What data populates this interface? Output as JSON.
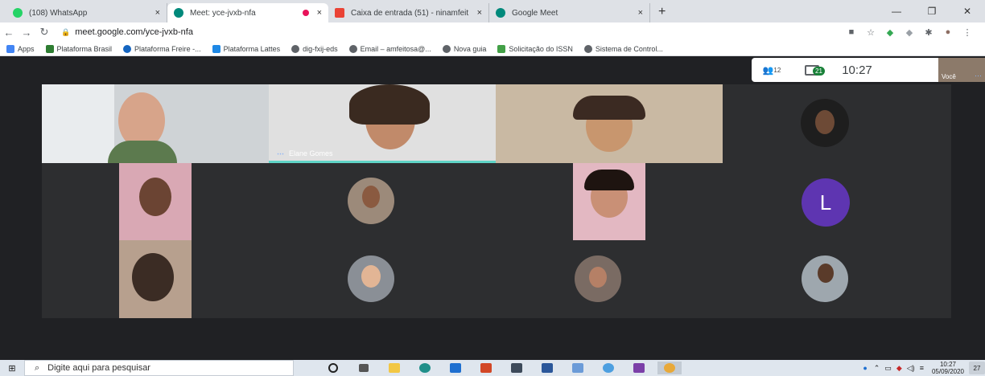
{
  "tabs": [
    {
      "title": "(108) WhatsApp",
      "color": "#25d366"
    },
    {
      "title": "Meet: yce-jvxb-nfa",
      "color": "#00897b"
    },
    {
      "title": "Caixa de entrada (51) - ninamfeit",
      "color": "#ea4335"
    },
    {
      "title": "Google Meet",
      "color": "#00897b"
    }
  ],
  "tab_close": "×",
  "new_tab": "+",
  "window": {
    "min": "—",
    "max": "❐",
    "close": "✕"
  },
  "url": "meet.google.com/yce-jvxb-nfa",
  "bookmarks": [
    {
      "label": "Apps",
      "color": "#4285f4"
    },
    {
      "label": "Plataforma Brasil",
      "color": "#2e7d32"
    },
    {
      "label": "Plataforma Freire -...",
      "color": "#1565c0"
    },
    {
      "label": "Plataforma Lattes",
      "color": "#1e88e5"
    },
    {
      "label": "dig-fxij-eds",
      "color": "#5f6368"
    },
    {
      "label": "Email – amfeitosa@...",
      "color": "#5f6368"
    },
    {
      "label": "Nova guia",
      "color": "#5f6368"
    },
    {
      "label": "Solicitação do ISSN",
      "color": "#43a047"
    },
    {
      "label": "Sistema de Control...",
      "color": "#5f6368"
    }
  ],
  "meet": {
    "participants": "12",
    "chat_badge": "21",
    "time": "10:27",
    "self_label": "Você",
    "self_dots": "⋯"
  },
  "tiles": {
    "speaker_name": "Elane Gomes",
    "letter_avatar": "L"
  },
  "taskbar": {
    "search_placeholder": "Digite aqui para pesquisar",
    "time": "10:27",
    "date": "05/09/2020",
    "notif_count": "27"
  }
}
